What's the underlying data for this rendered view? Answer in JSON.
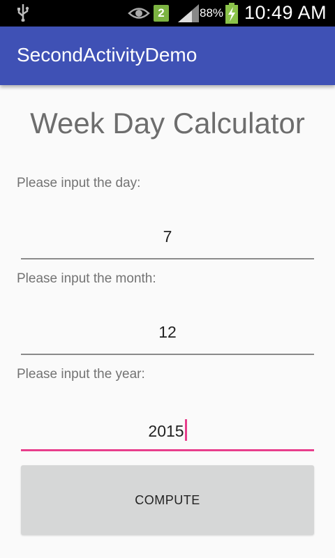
{
  "status_bar": {
    "notification_count": "2",
    "battery_percent": "88%",
    "time": "10:49 AM",
    "icons": [
      "usb-icon",
      "eye-icon",
      "notification-icon",
      "signal-icon",
      "battery-charging-icon"
    ]
  },
  "app_bar": {
    "title": "SecondActivityDemo",
    "color": "#3f51b5"
  },
  "page": {
    "title": "Week Day Calculator"
  },
  "form": {
    "day_label": "Please input the day:",
    "day_value": "7",
    "month_label": "Please input the month:",
    "month_value": "12",
    "year_label": "Please input the year:",
    "year_value": "2015",
    "accent_color": "#e83e8c"
  },
  "compute_button": {
    "label": "COMPUTE"
  }
}
